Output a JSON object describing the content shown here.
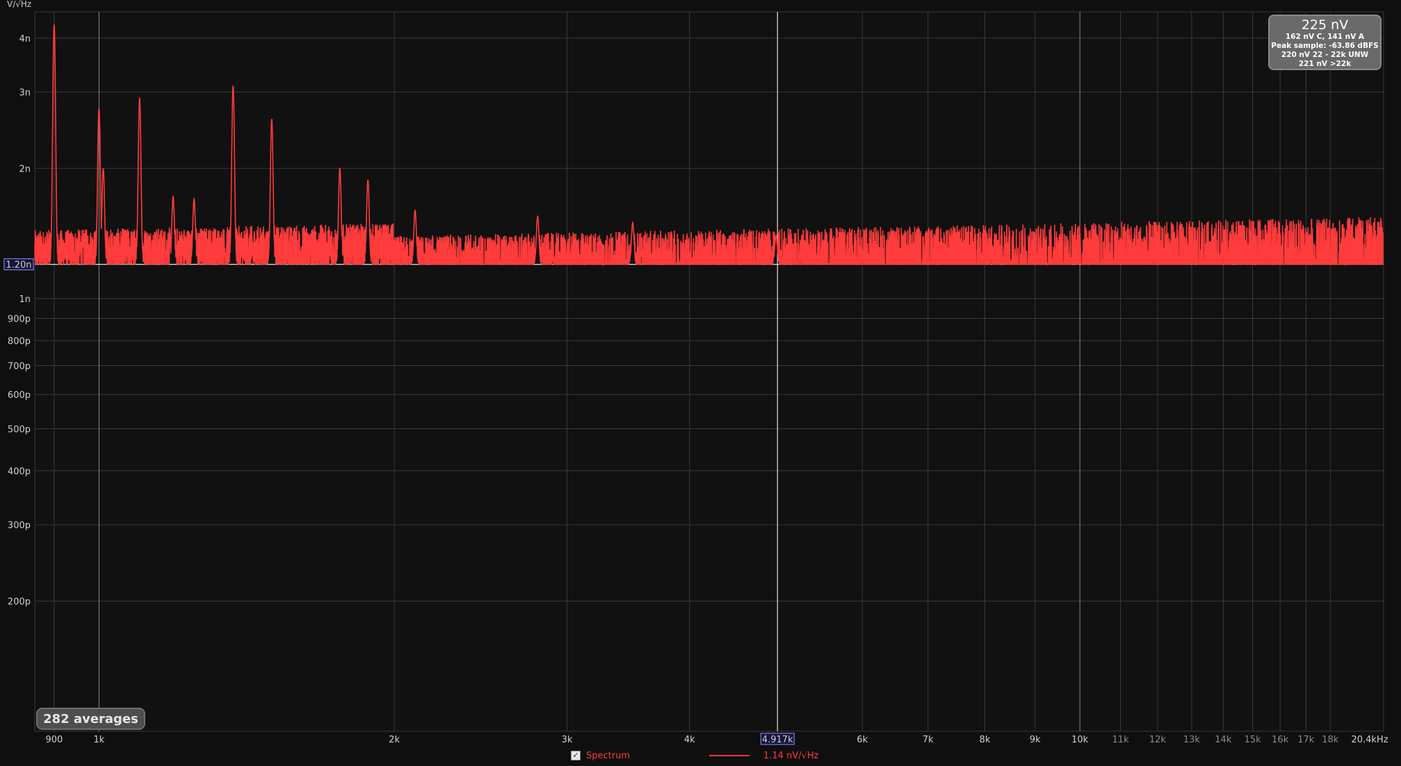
{
  "chart_data": {
    "type": "line",
    "title": "",
    "xlabel": "",
    "ylabel": "V/√Hz",
    "x_scale": "log",
    "y_scale": "log",
    "xlim": [
      860,
      20400
    ],
    "ylim": [
      1e-10,
      4.6e-09
    ],
    "grid": true,
    "x_ticks": [
      {
        "label": "900",
        "value": 900,
        "dim": false
      },
      {
        "label": "1k",
        "value": 1000,
        "dim": false
      },
      {
        "label": "2k",
        "value": 2000,
        "dim": false
      },
      {
        "label": "3k",
        "value": 3000,
        "dim": false
      },
      {
        "label": "4k",
        "value": 4000,
        "dim": false
      },
      {
        "label": "6k",
        "value": 6000,
        "dim": false
      },
      {
        "label": "7k",
        "value": 7000,
        "dim": false
      },
      {
        "label": "8k",
        "value": 8000,
        "dim": false
      },
      {
        "label": "9k",
        "value": 9000,
        "dim": false
      },
      {
        "label": "10k",
        "value": 10000,
        "dim": false
      },
      {
        "label": "11k",
        "value": 11000,
        "dim": true
      },
      {
        "label": "12k",
        "value": 12000,
        "dim": true
      },
      {
        "label": "13k",
        "value": 13000,
        "dim": true
      },
      {
        "label": "14k",
        "value": 14000,
        "dim": true
      },
      {
        "label": "15k",
        "value": 15000,
        "dim": true
      },
      {
        "label": "16k",
        "value": 16000,
        "dim": true
      },
      {
        "label": "17k",
        "value": 17000,
        "dim": true
      },
      {
        "label": "18k",
        "value": 18000,
        "dim": true
      },
      {
        "label": "20.4kHz",
        "value": 20400,
        "dim": false
      }
    ],
    "y_ticks": [
      {
        "label": "4n",
        "value": 4e-09
      },
      {
        "label": "3n",
        "value": 3e-09
      },
      {
        "label": "2n",
        "value": 2e-09
      },
      {
        "label": "1n",
        "value": 1e-09
      },
      {
        "label": "900p",
        "value": 9e-10
      },
      {
        "label": "800p",
        "value": 8e-10
      },
      {
        "label": "700p",
        "value": 7e-10
      },
      {
        "label": "600p",
        "value": 6e-10
      },
      {
        "label": "500p",
        "value": 5e-10
      },
      {
        "label": "400p",
        "value": 4e-10
      },
      {
        "label": "300p",
        "value": 3e-10
      },
      {
        "label": "200p",
        "value": 2e-10
      }
    ],
    "cursor_x": {
      "label": "4.917k",
      "value": 4917
    },
    "cursor_y": {
      "label": "1.20n",
      "value": 1.2e-09
    },
    "series": [
      {
        "name": "Spectrum",
        "color": "#ff3b3b",
        "noise_floor": 1.2e-09,
        "peaks": [
          {
            "x": 900,
            "y": 4.3e-09
          },
          {
            "x": 1000,
            "y": 2.75e-09
          },
          {
            "x": 1010,
            "y": 2e-09
          },
          {
            "x": 1100,
            "y": 2.9e-09
          },
          {
            "x": 1190,
            "y": 1.72e-09
          },
          {
            "x": 1250,
            "y": 1.7e-09
          },
          {
            "x": 1370,
            "y": 3.1e-09
          },
          {
            "x": 1500,
            "y": 2.6e-09
          },
          {
            "x": 1760,
            "y": 2e-09
          },
          {
            "x": 1880,
            "y": 1.88e-09
          },
          {
            "x": 2100,
            "y": 1.6e-09
          },
          {
            "x": 2800,
            "y": 1.55e-09
          },
          {
            "x": 3500,
            "y": 1.5e-09
          },
          {
            "x": 4900,
            "y": 1.4e-09
          }
        ]
      }
    ]
  },
  "stats_box": {
    "main": "225 nV",
    "line1": "162 nV C, 141 nV A",
    "line2": "Peak sample: -63.86 dBFS",
    "line3": "220 nV 22 - 22k UNW",
    "line4": "221 nV >22k"
  },
  "averages_label": "282 averages",
  "legend": {
    "checkbox_mark": "✓",
    "series_label": "Spectrum",
    "value_label": "1.14 nV/√Hz"
  }
}
